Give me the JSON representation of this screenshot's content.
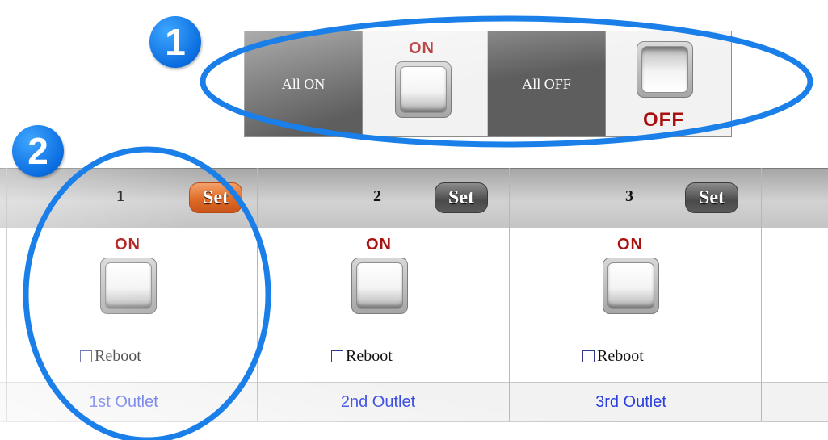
{
  "all_controls": {
    "all_on_label": "All ON",
    "all_off_label": "All OFF",
    "on_text": "ON",
    "off_text": "OFF"
  },
  "outlets": [
    {
      "number": "1",
      "set_label": "Set",
      "set_active": true,
      "state_text": "ON",
      "reboot_label": "Reboot",
      "reboot_checked": false,
      "name": "1st Outlet"
    },
    {
      "number": "2",
      "set_label": "Set",
      "set_active": false,
      "state_text": "ON",
      "reboot_label": "Reboot",
      "reboot_checked": false,
      "name": "2nd Outlet"
    },
    {
      "number": "3",
      "set_label": "Set",
      "set_active": false,
      "state_text": "ON",
      "reboot_label": "Reboot",
      "reboot_checked": false,
      "name": "3rd Outlet"
    }
  ],
  "callouts": [
    "1",
    "2"
  ],
  "colors": {
    "callout_blue": "#1a7fe8",
    "on_off_text": "#aa1010",
    "active_set": "#e06a25",
    "outlet_link": "#2a3ee0",
    "label_bg": "#5e5e5e"
  }
}
